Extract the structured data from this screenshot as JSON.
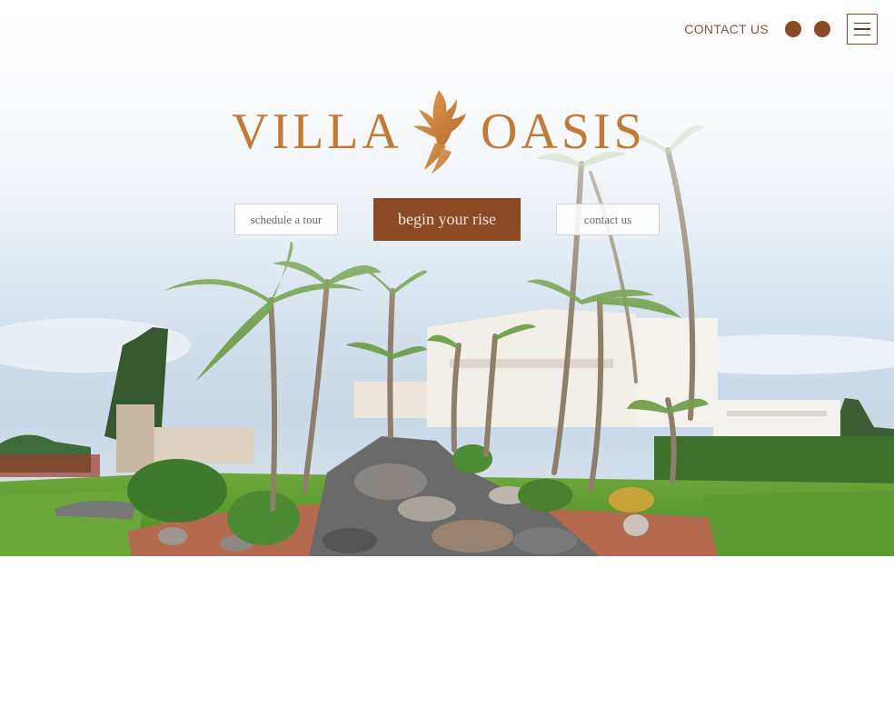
{
  "brand": {
    "name_left": "VILLA",
    "name_right": "OASIS",
    "logo_icon": "phoenix-wing-icon",
    "accent_color": "#c27a35",
    "primary_color": "#8c4a24"
  },
  "header": {
    "contact_label": "CONTACT US",
    "social_icons": [
      "social-icon",
      "social-icon"
    ],
    "menu_icon": "hamburger-menu-icon"
  },
  "hero": {
    "image": "resort-grounds-with-palm-trees-and-rock-garden",
    "buttons": {
      "schedule_tour": "schedule a tour",
      "begin": "begin your rise",
      "contact": "contact us"
    }
  }
}
